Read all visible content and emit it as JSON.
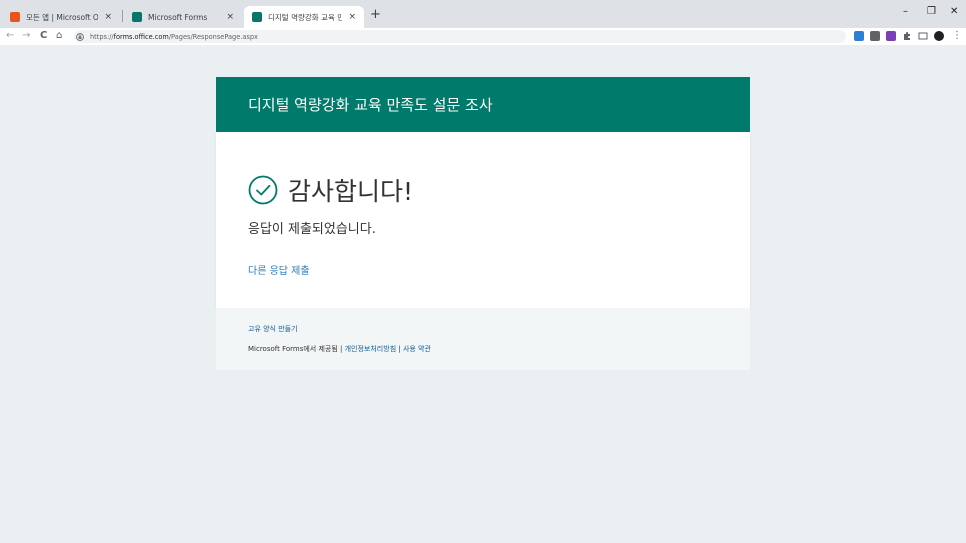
{
  "browser": {
    "tabs": [
      {
        "title": "모든 앱 | Microsoft Office",
        "close": "×",
        "favicon_color": "#e8541c"
      },
      {
        "title": "Microsoft Forms",
        "close": "×",
        "favicon_color": "#077568"
      },
      {
        "title": "디지털 역량강화 교육 만족도 설",
        "close": "×",
        "favicon_color": "#077568"
      }
    ],
    "new_tab": "+",
    "window": {
      "minimize": "–",
      "restore": "❐",
      "close": "✕"
    },
    "nav": {
      "back": "←",
      "forward": "→",
      "reload": "C",
      "home": "⌂"
    },
    "url": {
      "scheme": "https://",
      "host": "forms.office.com",
      "path": "/Pages/ResponsePage.aspx"
    },
    "menu": "⋮"
  },
  "form": {
    "header_title": "디지털 역량강화 교육 만족도 설문 조사",
    "thanks": "감사합니다!",
    "submitted": "응답이 제출되었습니다.",
    "submit_another": "다른 응답 제출",
    "accent_color": "#007a6a"
  },
  "footer": {
    "create_own": "고유 양식 만들기",
    "powered_by": "Microsoft Forms에서 제공됨",
    "sep1": " | ",
    "privacy": "개인정보처리방침",
    "sep2": " | ",
    "terms": "사용 약관"
  }
}
